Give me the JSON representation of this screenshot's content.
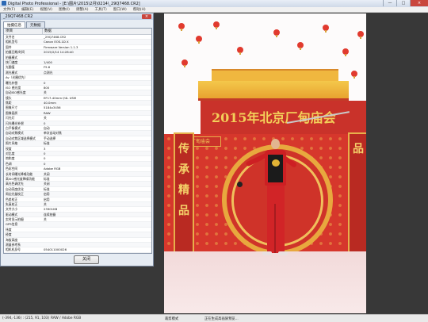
{
  "app": {
    "title": "Digital Photo Professional - [E:\\图片\\2015\\2月\\0214\\_29Q7468.CR2]",
    "window_buttons": [
      "—",
      "□",
      "×"
    ],
    "menu": [
      "文件(F)",
      "编辑(E)",
      "视图(V)",
      "图像(I)",
      "调整(A)",
      "工具(T)",
      "窗口(W)",
      "帮助(H)"
    ]
  },
  "dialog": {
    "title": "_29Q7468.CR2",
    "close_symbol": "×",
    "tabs": [
      "拍摄信息",
      "元数据"
    ],
    "columns": [
      "项目",
      "数据"
    ],
    "rows": [
      [
        "文件名",
        "_29Q7468.CR2"
      ],
      [
        "相机型号",
        "Canon EOS-1D X"
      ],
      [
        "固件",
        "Firmware Version 1.1.3"
      ],
      [
        "拍摄日期/时间",
        "2015/2/14 14:28:40"
      ],
      [
        "拍摄模式",
        ""
      ],
      [
        "快门速度",
        "1/400"
      ],
      [
        "光圈值",
        "F5.6"
      ],
      [
        "测光模式",
        "点测光"
      ],
      [
        "Av（光圈优先）",
        ""
      ],
      [
        "曝光补偿",
        "0"
      ],
      [
        "ISO 感光度",
        "800"
      ],
      [
        "自动ISO感光度",
        "关"
      ],
      [
        "镜头",
        "EF17-40mm f/4L USM"
      ],
      [
        "焦距",
        "40.0mm"
      ],
      [
        "图像尺寸",
        "5184x3456"
      ],
      [
        "图像画质",
        "RAW"
      ],
      [
        "闪光灯",
        "关"
      ],
      [
        "闪光曝光补偿",
        "0"
      ],
      [
        "白平衡模式",
        "自动"
      ],
      [
        "自动对焦模式",
        "单次自动对焦"
      ],
      [
        "自动对焦区域选择模式",
        "手动选择"
      ],
      [
        "照片风格",
        "标准"
      ],
      [
        "锐度",
        "3"
      ],
      [
        "对比度",
        "0"
      ],
      [
        "饱和度",
        "0"
      ],
      [
        "色调",
        "0"
      ],
      [
        "色彩空间",
        "Adobe RGB"
      ],
      [
        "长时间曝光降噪功能",
        "关闭"
      ],
      [
        "高ISO感光度降噪功能",
        "标准"
      ],
      [
        "高光色调优先",
        "关闭"
      ],
      [
        "自动亮度优化",
        "标准"
      ],
      [
        "周边光量校正",
        "启用"
      ],
      [
        "色差校正",
        "启用"
      ],
      [
        "失真校正",
        "关"
      ],
      [
        "文件大小",
        "23901KB"
      ],
      [
        "驱动模式",
        "连续拍摄"
      ],
      [
        "实时显示拍摄",
        "关"
      ],
      [
        "GPS信息",
        ""
      ],
      [
        "纬度",
        ""
      ],
      [
        "经度",
        ""
      ],
      [
        "海拔高度",
        ""
      ],
      [
        "测量参考系",
        ""
      ],
      [
        "相机机身号",
        "054011000026"
      ],
      [
        "评级",
        "无"
      ]
    ],
    "close_button": "关闭"
  },
  "photo": {
    "banner_text": "2015年北京厂甸庙会",
    "small_sign_text": "厂甸庙会",
    "left_pillar_text": "传承精品",
    "right_pillar_text": "品",
    "colors": {
      "banner": "#c9322a",
      "lantern": "#e13a2e",
      "gold": "#f3cf59"
    }
  },
  "statusbar": {
    "left": "(-394,-136) : (215, 91, 103)",
    "middle": "RAW / Adobe RGB",
    "right_label": "裁剪模式",
    "progress_text": "正在生成高画质预览..."
  }
}
